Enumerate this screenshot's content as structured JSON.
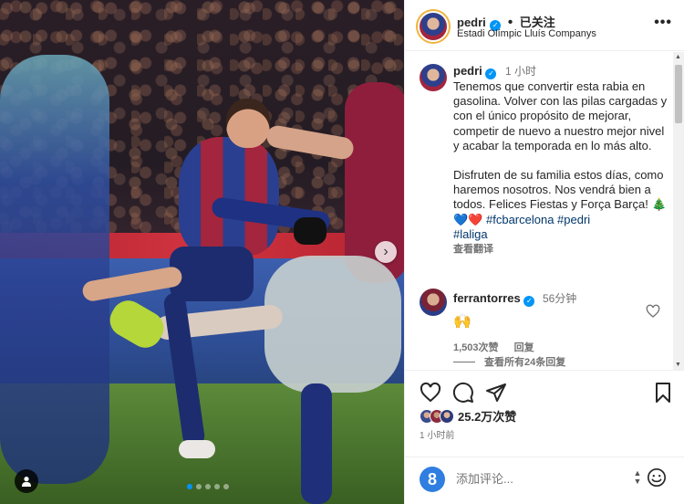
{
  "post": {
    "username": "pedri",
    "verified_mark": "✓",
    "follow_label": "已关注",
    "location": "Estadi Olímpic Lluís Companys",
    "more_label": "•••"
  },
  "caption": {
    "username": "pedri",
    "time": "1 小时",
    "paragraph1": "Tenemos que convertir esta rabia en gasolina. Volver con las pilas cargadas y con el único propósito de mejorar, competir de nuevo a nuestro mejor nivel y acabar la temporada en lo más alto.",
    "paragraph2": "Disfruten de su familia estos días, como haremos nosotros. Nos vendrá bien a todos. Felices Fiestas y Força Barça! 🎄💙❤️",
    "hashtags": "#fcbarcelona #pedri",
    "hashtag2": "#laliga",
    "translate": "查看翻译"
  },
  "comment": {
    "username": "ferrantorres",
    "time": "56分钟",
    "body": "🙌",
    "likes": "1,503次赞",
    "reply": "回复",
    "view_replies": "查看所有24条回复"
  },
  "actions": {
    "likes": "25.2万次赞",
    "posted": "1 小时前"
  },
  "composer": {
    "placeholder": "添加评论...",
    "icon_letter": "8"
  },
  "carousel": {
    "next": "›",
    "slides_total": 5,
    "active_slide": 1
  },
  "colors": {
    "accent_blue": "#0095f6",
    "text": "#262626",
    "secondary_text": "#737373",
    "link": "#00376b"
  },
  "icons": {
    "heart": "heart-icon",
    "comment": "comment-icon",
    "share": "share-icon",
    "bookmark": "bookmark-icon",
    "emoji": "emoji-icon",
    "tag": "user-tag-icon"
  }
}
